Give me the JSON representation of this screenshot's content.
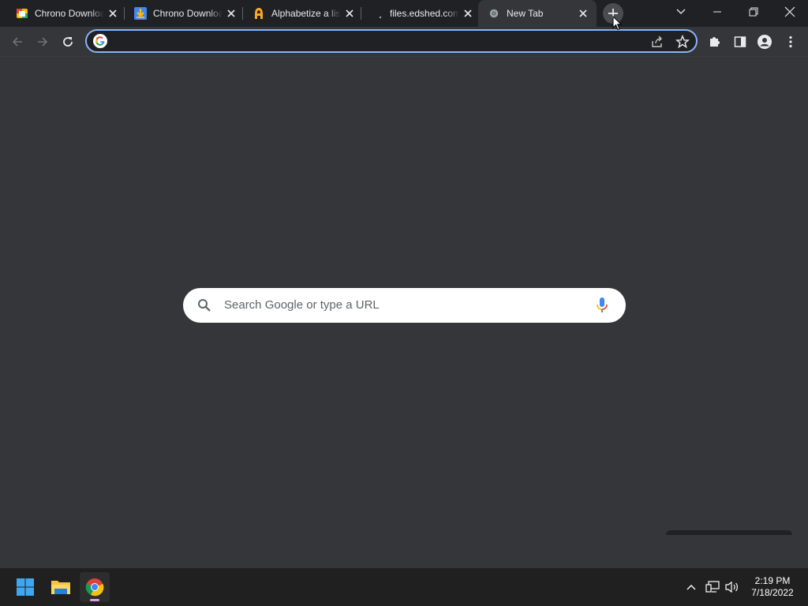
{
  "tabs": [
    {
      "title": "Chrono Download Manager",
      "favicon": "chrono-colorful-icon"
    },
    {
      "title": "Chrono Download Manager",
      "favicon": "download-arrow-icon"
    },
    {
      "title": "Alphabetize a list",
      "favicon": "orange-a-icon"
    },
    {
      "title": "files.edshed.com",
      "favicon": "blank-page-icon"
    },
    {
      "title": "New Tab",
      "favicon": "chrome-icon",
      "active": true
    }
  ],
  "omnibox": {
    "value": "",
    "placeholder": ""
  },
  "search": {
    "placeholder": "Search Google or type a URL"
  },
  "clock": {
    "time": "2:19 PM",
    "date": "7/18/2022"
  },
  "colors": {
    "accent": "#8ab4f8",
    "background": "#35363a",
    "tabstrip": "#202124",
    "taskbar": "#202020"
  }
}
